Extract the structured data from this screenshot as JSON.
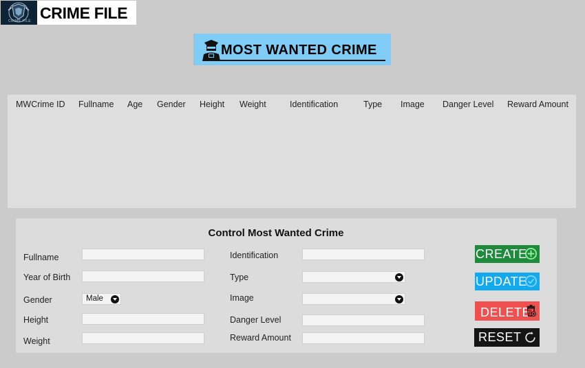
{
  "app": {
    "logo_text": "CRIME FILE",
    "badge_text": "CRIME FILE",
    "banner_text": "MOST WANTED CRIME"
  },
  "table": {
    "columns": [
      "MWCrime ID",
      "Fullname",
      "Age",
      "Gender",
      "Height",
      "Weight",
      "Identification",
      "Type",
      "Image",
      "Danger Level",
      "Reward Amount"
    ],
    "rows": []
  },
  "form": {
    "title": "Control Most Wanted Crime",
    "fullname": {
      "label": "Fullname",
      "value": ""
    },
    "year_of_birth": {
      "label": "Year of Birth",
      "value": ""
    },
    "gender": {
      "label": "Gender",
      "value": "Male"
    },
    "height": {
      "label": "Height",
      "value": ""
    },
    "weight": {
      "label": "Weight",
      "value": ""
    },
    "identification": {
      "label": "Identification",
      "value": ""
    },
    "type": {
      "label": "Type",
      "value": ""
    },
    "image": {
      "label": "Image",
      "value": ""
    },
    "danger_level": {
      "label": "Danger Level",
      "value": ""
    },
    "reward_amount": {
      "label": "Reward Amount",
      "value": ""
    }
  },
  "actions": {
    "create": {
      "label": "CREATE",
      "color": "#1e8a3c",
      "icon": "plus-circle-icon"
    },
    "update": {
      "label": "UPDATE",
      "color": "#12a9ee",
      "icon": "check-circle-icon"
    },
    "delete": {
      "label": "DELETE",
      "color": "#f05050",
      "icon": "trash-icon"
    },
    "reset": {
      "label": "RESET",
      "color": "#151515",
      "icon": "reset-icon"
    }
  }
}
